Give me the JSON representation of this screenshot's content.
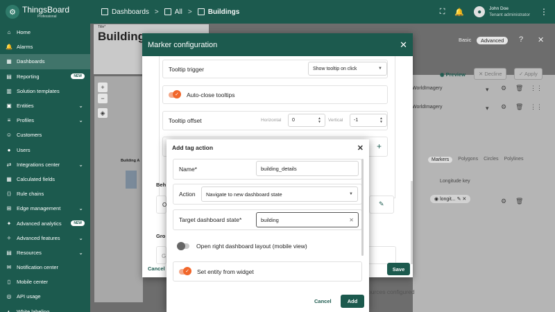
{
  "app": {
    "name": "ThingsBoard",
    "edition": "Professional"
  },
  "breadcrumbs": [
    "Dashboards",
    "All",
    "Buildings"
  ],
  "user": {
    "name": "John Doe",
    "role": "Tenant administrator"
  },
  "sidebar": {
    "items": [
      {
        "label": "Home",
        "icon": "home-icon",
        "chevron": false,
        "badge": ""
      },
      {
        "label": "Alarms",
        "icon": "bell-icon",
        "chevron": false,
        "badge": ""
      },
      {
        "label": "Dashboards",
        "icon": "dashboard-icon",
        "chevron": false,
        "badge": "",
        "active": true
      },
      {
        "label": "Reporting",
        "icon": "report-icon",
        "chevron": false,
        "badge": "NEW"
      },
      {
        "label": "Solution templates",
        "icon": "template-icon",
        "chevron": false,
        "badge": ""
      },
      {
        "label": "Entities",
        "icon": "entities-icon",
        "chevron": true,
        "badge": ""
      },
      {
        "label": "Profiles",
        "icon": "profiles-icon",
        "chevron": true,
        "badge": ""
      },
      {
        "label": "Customers",
        "icon": "customers-icon",
        "chevron": false,
        "badge": ""
      },
      {
        "label": "Users",
        "icon": "users-icon",
        "chevron": false,
        "badge": ""
      },
      {
        "label": "Integrations center",
        "icon": "integrations-icon",
        "chevron": true,
        "badge": ""
      },
      {
        "label": "Calculated fields",
        "icon": "calculator-icon",
        "chevron": false,
        "badge": ""
      },
      {
        "label": "Rule chains",
        "icon": "rule-chain-icon",
        "chevron": false,
        "badge": ""
      },
      {
        "label": "Edge management",
        "icon": "edge-icon",
        "chevron": true,
        "badge": ""
      },
      {
        "label": "Advanced analytics",
        "icon": "analytics-icon",
        "chevron": false,
        "badge": "NEW"
      },
      {
        "label": "Advanced features",
        "icon": "features-icon",
        "chevron": true,
        "badge": ""
      },
      {
        "label": "Resources",
        "icon": "resources-icon",
        "chevron": true,
        "badge": ""
      },
      {
        "label": "Notification center",
        "icon": "notification-icon",
        "chevron": false,
        "badge": ""
      },
      {
        "label": "Mobile center",
        "icon": "mobile-icon",
        "chevron": false,
        "badge": ""
      },
      {
        "label": "API usage",
        "icon": "api-icon",
        "chevron": false,
        "badge": ""
      },
      {
        "label": "White labeling",
        "icon": "palette-icon",
        "chevron": true,
        "badge": ""
      }
    ]
  },
  "background": {
    "title_small": "Title*",
    "title": "Buildings",
    "building_label": "Building A",
    "mode_basic": "Basic",
    "mode_advanced": "Advanced",
    "preview": "Preview",
    "decline": "Decline",
    "apply": "Apply",
    "imagery": [
      "WorldImagery",
      "WorldImagery"
    ],
    "tabs": [
      "Markers",
      "Polygons",
      "Circles",
      "Polylines"
    ],
    "longitude_key": "Longitude key",
    "chip": "longit...",
    "behavior_fragment": "Beh",
    "groups_fragment": "Gro",
    "o_fragment": "O",
    "g_fragment": "G",
    "no_sources": "ources configured"
  },
  "marker_dialog": {
    "title": "Marker configuration",
    "tooltip_trigger_label": "Tooltip trigger",
    "tooltip_trigger_value": "Show tooltip on click",
    "auto_close_label": "Auto-close tooltips",
    "tooltip_offset_label": "Tooltip offset",
    "horizontal_label": "Horizontal",
    "horizontal_value": "0",
    "vertical_label": "Vertical",
    "vertical_value": "-1",
    "cancel": "Cancel",
    "save": "Save"
  },
  "tag_dialog": {
    "title": "Add tag action",
    "name_label": "Name*",
    "name_value": "building_details",
    "action_label": "Action",
    "action_value": "Navigate to new dashboard state",
    "target_label": "Target dashboard state*",
    "target_value": "building",
    "open_right_label": "Open right dashboard layout (mobile view)",
    "set_entity_label": "Set entity from widget",
    "cancel": "Cancel",
    "add": "Add"
  }
}
